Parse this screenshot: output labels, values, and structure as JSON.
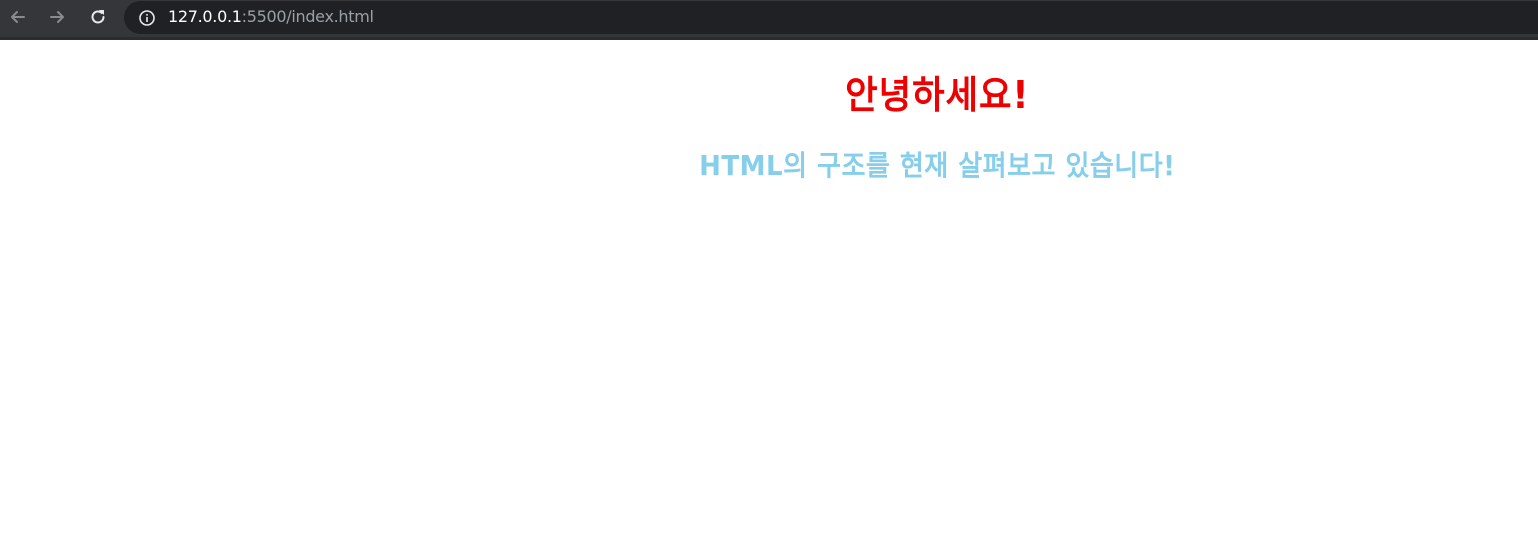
{
  "browser": {
    "url_host": "127.0.0.1",
    "url_rest": ":5500/index.html",
    "icons": {
      "back": "arrow-left-icon",
      "forward": "arrow-right-icon",
      "reload": "reload-icon",
      "info": "info-icon"
    },
    "colors": {
      "toolbar": "#35363a",
      "omnibox": "#202124"
    }
  },
  "page": {
    "heading": "안녕하세요!",
    "subheading": "HTML의 구조를 현재 살펴보고 있습니다!",
    "colors": {
      "heading": "#ee0000",
      "subheading": "#87ceeb",
      "background": "#ffffff"
    }
  }
}
